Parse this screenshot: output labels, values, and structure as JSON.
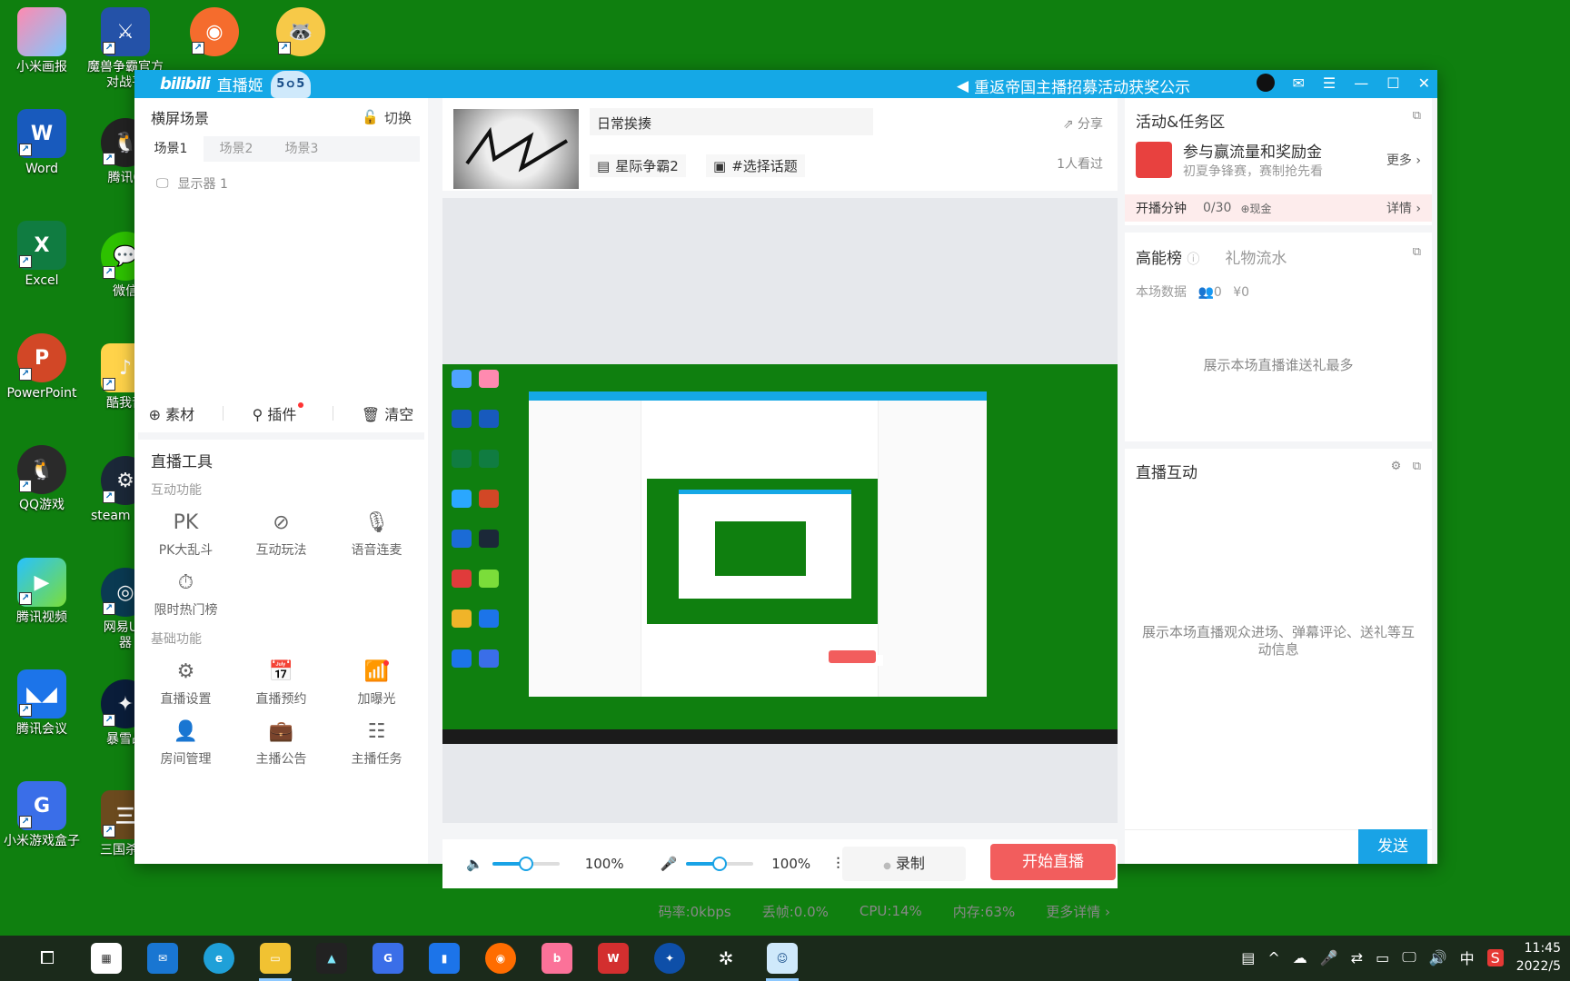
{
  "desktop": {
    "icons_col1": [
      "小米画报",
      "Word",
      "Excel",
      "PowerPoint",
      "QQ游戏",
      "腾讯视频",
      "腾讯会议",
      "小米游戏盒子"
    ],
    "icons_col2": [
      "魔兽争霸官方\n对战平",
      "腾讯Q",
      "微信",
      "酷我音",
      "steam 方式",
      "网易UU\n器",
      "暴雪战",
      "三国杀一"
    ]
  },
  "app": {
    "logo_text": "bilibili",
    "app_name": "直播姬",
    "mascot_label": "5ｏ5",
    "notice": "重返帝国主播招募活动获奖公示",
    "scene": {
      "title": "横屏场景",
      "switch_label": "切换",
      "tabs": [
        "场景1",
        "场景2",
        "场景3"
      ],
      "source": "显示器 1",
      "tools": [
        "素材",
        "插件",
        "清空"
      ]
    },
    "live_tools": {
      "title": "直播工具",
      "interactive_title": "互动功能",
      "interactive": [
        "PK大乱斗",
        "互动玩法",
        "语音连麦",
        "限时热门榜"
      ],
      "basic_title": "基础功能",
      "basic": [
        "直播设置",
        "直播预约",
        "加曝光",
        "房间管理",
        "主播公告",
        "主播任务"
      ]
    },
    "stream_info": {
      "title": "日常挨揍",
      "share": "分享",
      "category": "星际争霸2",
      "topic": "#选择话题",
      "viewers": "1人看过"
    },
    "controls": {
      "speaker_volume": "100%",
      "speaker_level": 0.5,
      "mic_volume": "100%",
      "mic_level": 0.5,
      "record_label": "录制",
      "start_live_label": "开始直播"
    },
    "status": {
      "bitrate": "码率:0kbps",
      "drop": "丢帧:0.0%",
      "cpu": "CPU:14%",
      "memory": "内存:63%",
      "more": "更多详情"
    },
    "activity": {
      "title": "活动&任务区",
      "main": "参与赢流量和奖励金",
      "sub": "初夏争锋赛，赛制抢先看",
      "more": "更多",
      "kaibo_label": "开播分钟",
      "kaibo_progress": "0/30",
      "kaibo_reward": "现金",
      "detail": "详情"
    },
    "ranking": {
      "tab_active": "高能榜",
      "tab_inactive": "礼物流水",
      "stats_label": "本场数据",
      "stats_people": "0",
      "stats_money": "¥0",
      "empty_msg": "展示本场直播谁送礼最多"
    },
    "interaction": {
      "title": "直播互动",
      "empty_msg": "展示本场直播观众进场、弹幕评论、送礼等互动信息",
      "send_label": "发送"
    }
  },
  "taskbar": {
    "ime": "中",
    "time": "11:45",
    "date": "2022/5"
  },
  "colors": {
    "desktop": "#0f7f0f",
    "titlebar": "#15a8e6",
    "live_button": "#f25d5d",
    "accent": "#19a3e6"
  }
}
